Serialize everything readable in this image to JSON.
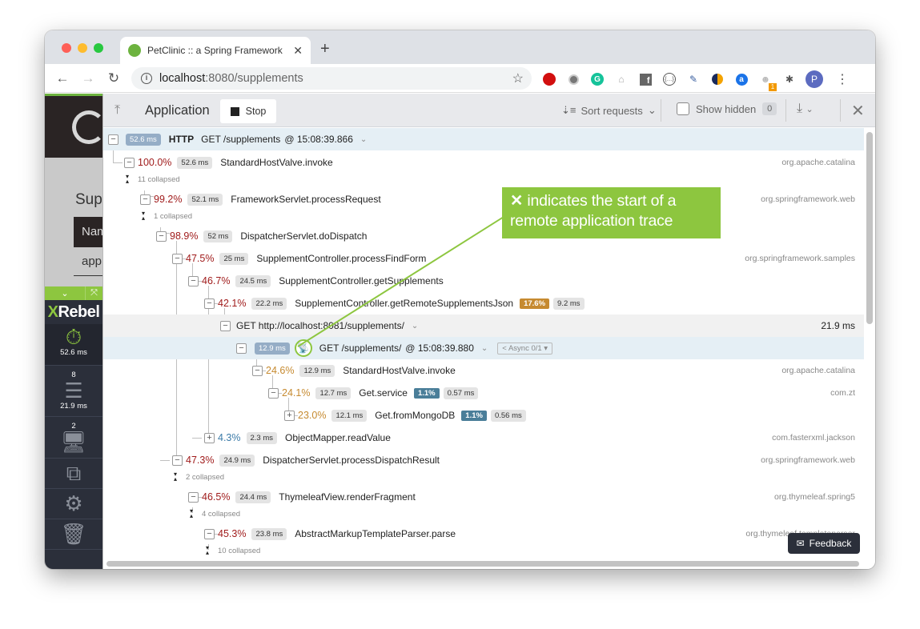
{
  "browser": {
    "tab_title": "PetClinic :: a Spring Framework",
    "url_host": "localhost",
    "url_path": ":8080/supplements",
    "profile_initial": "P",
    "extension_badge": "1"
  },
  "page": {
    "heading_partial": "Sup",
    "table_header_partial": "Nam",
    "table_cell_partial": "app"
  },
  "xrebel": {
    "brand_x": "X",
    "brand_rest": "Rebel",
    "sections": [
      {
        "name": "timing",
        "count": "",
        "value": "52.6 ms"
      },
      {
        "name": "database",
        "count": "8",
        "value": "21.9 ms"
      },
      {
        "name": "remote-calls",
        "count": "2",
        "value": ""
      },
      {
        "name": "popout",
        "count": "",
        "value": ""
      },
      {
        "name": "settings",
        "count": "",
        "value": ""
      },
      {
        "name": "trash",
        "count": "",
        "value": ""
      }
    ]
  },
  "toolbar": {
    "title": "Application",
    "stop_label": "Stop",
    "sort_label": "Sort requests",
    "show_hidden_label": "Show hidden",
    "hidden_count": "0"
  },
  "root": {
    "duration": "52.6 ms",
    "type": "HTTP",
    "request": "GET /supplements",
    "timestamp": "@ 15:08:39.866"
  },
  "rows": [
    {
      "pct": "100.0%",
      "ms": "52.6 ms",
      "method": "StandardHostValve.invoke",
      "pkg": "org.apache.catalina"
    },
    {
      "pct": "99.2%",
      "ms": "52.1 ms",
      "method": "FrameworkServlet.processRequest",
      "pkg": "org.springframework.web"
    },
    {
      "pct": "98.9%",
      "ms": "52 ms",
      "method": "DispatcherServlet.doDispatch",
      "pkg": ""
    },
    {
      "pct": "47.5%",
      "ms": "25 ms",
      "method": "SupplementController.processFindForm",
      "pkg": "org.springframework.samples"
    },
    {
      "pct": "46.7%",
      "ms": "24.5 ms",
      "method": "SupplementController.getSupplements",
      "pkg": ""
    },
    {
      "pct": "42.1%",
      "ms": "22.2 ms",
      "method": "SupplementController.getRemoteSupplementsJson",
      "pkg": "",
      "badge": "17.6%",
      "badge_ms": "9.2 ms"
    },
    {
      "pct": "24.6%",
      "ms": "12.9 ms",
      "method": "StandardHostValve.invoke",
      "pkg": "org.apache.catalina"
    },
    {
      "pct": "24.1%",
      "ms": "12.7 ms",
      "method": "Get.service",
      "pkg": "com.zt",
      "badge": "1.1%",
      "badge_ms": "0.57 ms"
    },
    {
      "pct": "23.0%",
      "ms": "12.1 ms",
      "method": "Get.fromMongoDB",
      "pkg": "",
      "badge": "1.1%",
      "badge_ms": "0.56 ms"
    },
    {
      "pct": "4.3%",
      "ms": "2.3 ms",
      "method": "ObjectMapper.readValue",
      "pkg": "com.fasterxml.jackson"
    },
    {
      "pct": "47.3%",
      "ms": "24.9 ms",
      "method": "DispatcherServlet.processDispatchResult",
      "pkg": "org.springframework.web"
    },
    {
      "pct": "46.5%",
      "ms": "24.4 ms",
      "method": "ThymeleafView.renderFragment",
      "pkg": "org.thymeleaf.spring5"
    },
    {
      "pct": "45.3%",
      "ms": "23.8 ms",
      "method": "AbstractMarkupTemplateParser.parse",
      "pkg": "org.thymeleaf.templateparser"
    }
  ],
  "collapsed": [
    "11 collapsed",
    "1 collapsed",
    "2 collapsed",
    "4 collapsed",
    "10 collapsed"
  ],
  "remote_call": {
    "label": "GET http://localhost:8081/supplements/",
    "duration": "21.9 ms"
  },
  "remote_trace": {
    "duration": "12.9 ms",
    "request": "GET /supplements/",
    "timestamp": "@ 15:08:39.880",
    "async_label": "Async 0/1"
  },
  "callout": {
    "text": "indicates the start of a remote application trace"
  },
  "feedback_label": "Feedback",
  "colors": {
    "accent_green": "#8dc63f",
    "high_pct": "#a01c1c",
    "mid_pct": "#c68a30",
    "low_pct": "#3b7ba8",
    "sidebar_dark": "#2b2f3a"
  }
}
